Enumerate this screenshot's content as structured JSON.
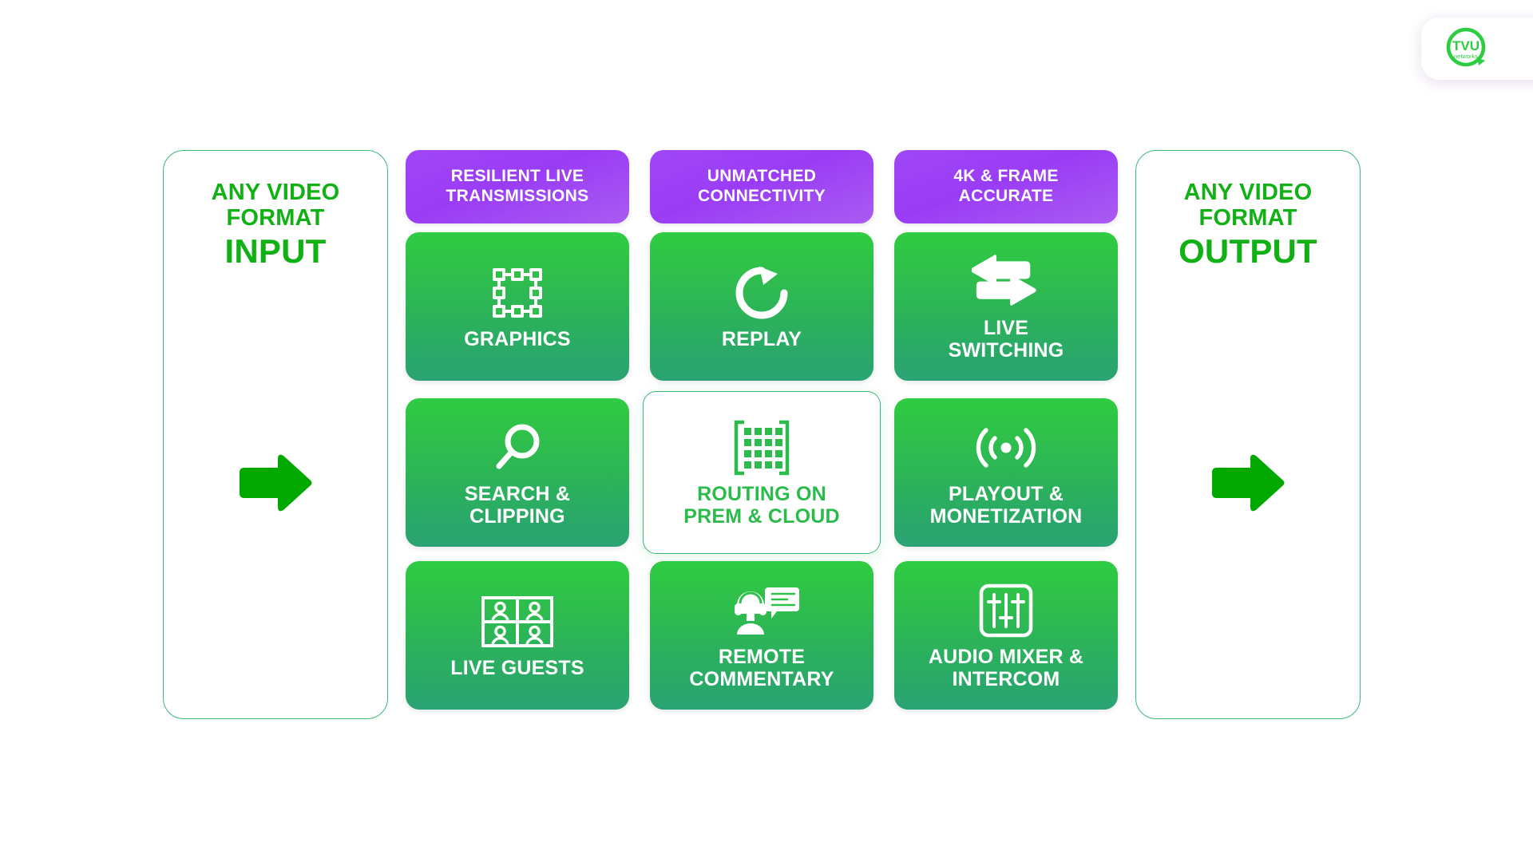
{
  "brand": {
    "logo_icon": "tvu-networks-logo",
    "name": "TVU",
    "sub": "networks",
    "accent_green": "#2ebb4e",
    "accent_purple": "#a047f7",
    "arrow_green": "#00a800",
    "title_green": "#11b015"
  },
  "input_panel": {
    "line1": "ANY VIDEO",
    "line2": "FORMAT",
    "emphasis": "INPUT",
    "arrow_icon": "arrow-right-icon"
  },
  "output_panel": {
    "line1": "ANY VIDEO",
    "line2": "FORMAT",
    "emphasis": "OUTPUT",
    "arrow_icon": "arrow-right-icon"
  },
  "columns": [
    {
      "header": "RESILIENT LIVE\nTRANSMISSIONS",
      "header_line1": "RESILIENT LIVE",
      "header_line2": "TRANSMISSIONS",
      "tiles": [
        {
          "label_line1": "GRAPHICS",
          "label_line2": "",
          "icon": "selection-box-icon",
          "active": false
        },
        {
          "label_line1": "SEARCH &",
          "label_line2": "CLIPPING",
          "icon": "magnifier-icon",
          "active": false
        },
        {
          "label_line1": "LIVE GUESTS",
          "label_line2": "",
          "icon": "video-grid-icon",
          "active": false
        }
      ]
    },
    {
      "header": "UNMATCHED\nCONNECTIVITY",
      "header_line1": "UNMATCHED",
      "header_line2": "CONNECTIVITY",
      "tiles": [
        {
          "label_line1": "REPLAY",
          "label_line2": "",
          "icon": "replay-circle-arrow-icon",
          "active": false
        },
        {
          "label_line1": "ROUTING ON",
          "label_line2": "PREM & CLOUD",
          "icon": "routing-matrix-icon",
          "active": true
        },
        {
          "label_line1": "REMOTE",
          "label_line2": "COMMENTARY",
          "icon": "headset-person-chat-icon",
          "active": false
        }
      ]
    },
    {
      "header": "4K & FRAME\nACCURATE",
      "header_line1": "4K & FRAME",
      "header_line2": "ACCURATE",
      "tiles": [
        {
          "label_line1": "LIVE",
          "label_line2": "SWITCHING",
          "icon": "switch-arrows-icon",
          "active": false
        },
        {
          "label_line1": "PLAYOUT &",
          "label_line2": "MONETIZATION",
          "icon": "broadcast-signal-icon",
          "active": false
        },
        {
          "label_line1": "AUDIO MIXER &",
          "label_line2": "INTERCOM",
          "icon": "audio-faders-icon",
          "active": false
        }
      ]
    }
  ]
}
